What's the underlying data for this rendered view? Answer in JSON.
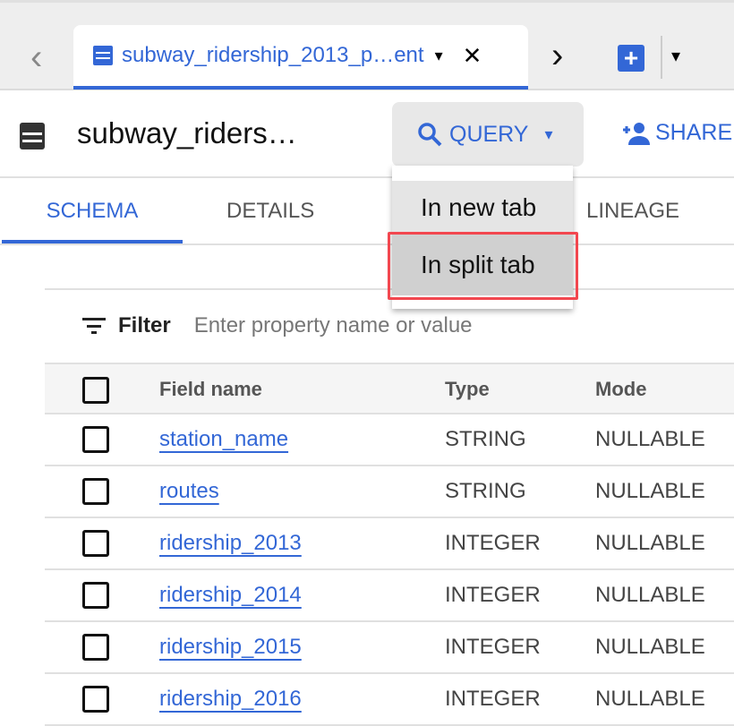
{
  "tabbar": {
    "active_tab": "subway_ridership_2013_p…ent",
    "close": "✕",
    "prev": "‹",
    "next": "›",
    "caret": "▾"
  },
  "header": {
    "title": "subway_riders…",
    "query_label": "QUERY",
    "share_label": "SHARE"
  },
  "tabs": [
    {
      "label": "SCHEMA"
    },
    {
      "label": "DETAILS"
    },
    {
      "label": "LINEAGE"
    }
  ],
  "query_menu": {
    "items": [
      {
        "label": "In new tab"
      },
      {
        "label": "In split tab"
      }
    ],
    "highlighted": "In split tab"
  },
  "filter": {
    "label": "Filter",
    "placeholder": "Enter property name or value"
  },
  "table": {
    "columns": [
      "Field name",
      "Type",
      "Mode"
    ],
    "rows": [
      {
        "name": "station_name",
        "type": "STRING",
        "mode": "NULLABLE"
      },
      {
        "name": "routes",
        "type": "STRING",
        "mode": "NULLABLE"
      },
      {
        "name": "ridership_2013",
        "type": "INTEGER",
        "mode": "NULLABLE"
      },
      {
        "name": "ridership_2014",
        "type": "INTEGER",
        "mode": "NULLABLE"
      },
      {
        "name": "ridership_2015",
        "type": "INTEGER",
        "mode": "NULLABLE"
      },
      {
        "name": "ridership_2016",
        "type": "INTEGER",
        "mode": "NULLABLE"
      }
    ]
  },
  "colors": {
    "accent": "#3367d6",
    "highlight": "#f2474f"
  }
}
